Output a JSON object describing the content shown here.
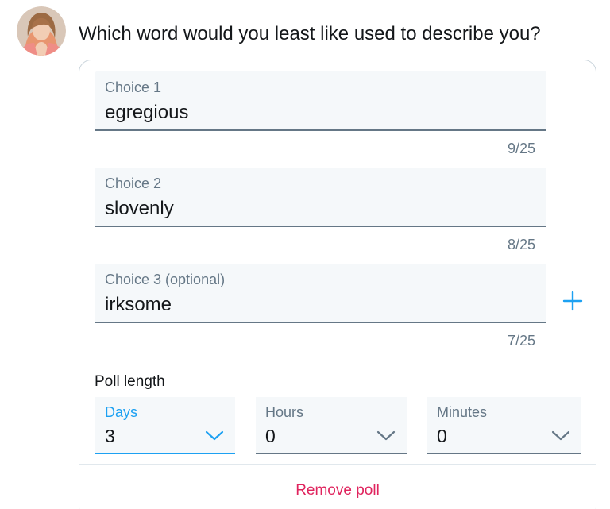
{
  "tweet": {
    "question": "Which word would you least like used to describe you?"
  },
  "poll": {
    "choices": [
      {
        "label": "Choice 1",
        "value": "egregious",
        "counter": "9/25"
      },
      {
        "label": "Choice 2",
        "value": "slovenly",
        "counter": "8/25"
      },
      {
        "label": "Choice 3 (optional)",
        "value": "irksome",
        "counter": "7/25"
      }
    ],
    "add_choice_icon": "plus-icon",
    "length": {
      "label": "Poll length",
      "days": {
        "label": "Days",
        "value": "3"
      },
      "hours": {
        "label": "Hours",
        "value": "0"
      },
      "minutes": {
        "label": "Minutes",
        "value": "0"
      }
    },
    "remove_label": "Remove poll"
  },
  "colors": {
    "accent": "#1da1f2",
    "danger": "#e0245e",
    "field_background": "#f5f8fa",
    "muted_text": "#657786",
    "border": "#ccd6dd"
  }
}
